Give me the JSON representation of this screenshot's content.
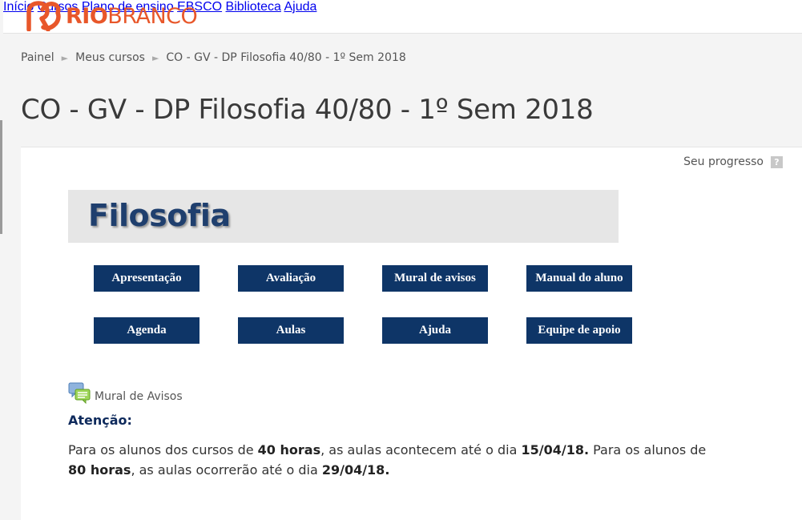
{
  "brand": {
    "name_part1": "RIO",
    "name_part2": "BRANCO",
    "color": "#e8572a"
  },
  "nav": {
    "items": [
      {
        "label": "Início",
        "icon": null
      },
      {
        "label": "Cursos"
      },
      {
        "label": "Plano de ensino"
      },
      {
        "label": "EBSCO"
      },
      {
        "label": "Biblioteca"
      },
      {
        "label": "Ajuda"
      }
    ]
  },
  "breadcrumb": {
    "items": [
      "Painel",
      "Meus cursos",
      "CO - GV - DP Filosofia 40/80 - 1º Sem 2018"
    ],
    "separator": "►"
  },
  "page": {
    "title": "CO - GV - DP Filosofia 40/80 - 1º Sem 2018"
  },
  "progress": {
    "label": "Seu progresso",
    "help_glyph": "?"
  },
  "banner": {
    "title": "Filosofia"
  },
  "buttons": {
    "row1": [
      "Apresentação",
      "Avaliação",
      "Mural de avisos",
      "Manual do aluno"
    ],
    "row2": [
      "Agenda",
      "Aulas",
      "Ajuda",
      "Equipe de apoio"
    ],
    "color": "#0e3567"
  },
  "forum": {
    "label": "Mural de Avisos",
    "icon": "forum-icon"
  },
  "notice": {
    "heading": "Atenção:",
    "t1": "Para os alunos dos cursos de ",
    "b1": "40 horas",
    "t2": ", as aulas acontecem até o dia ",
    "b2": "15/04/18.",
    "t3": " Para os alunos de ",
    "b3": "80 horas",
    "t4": ", as aulas ocorrerão até o dia ",
    "b4": "29/04/18."
  }
}
